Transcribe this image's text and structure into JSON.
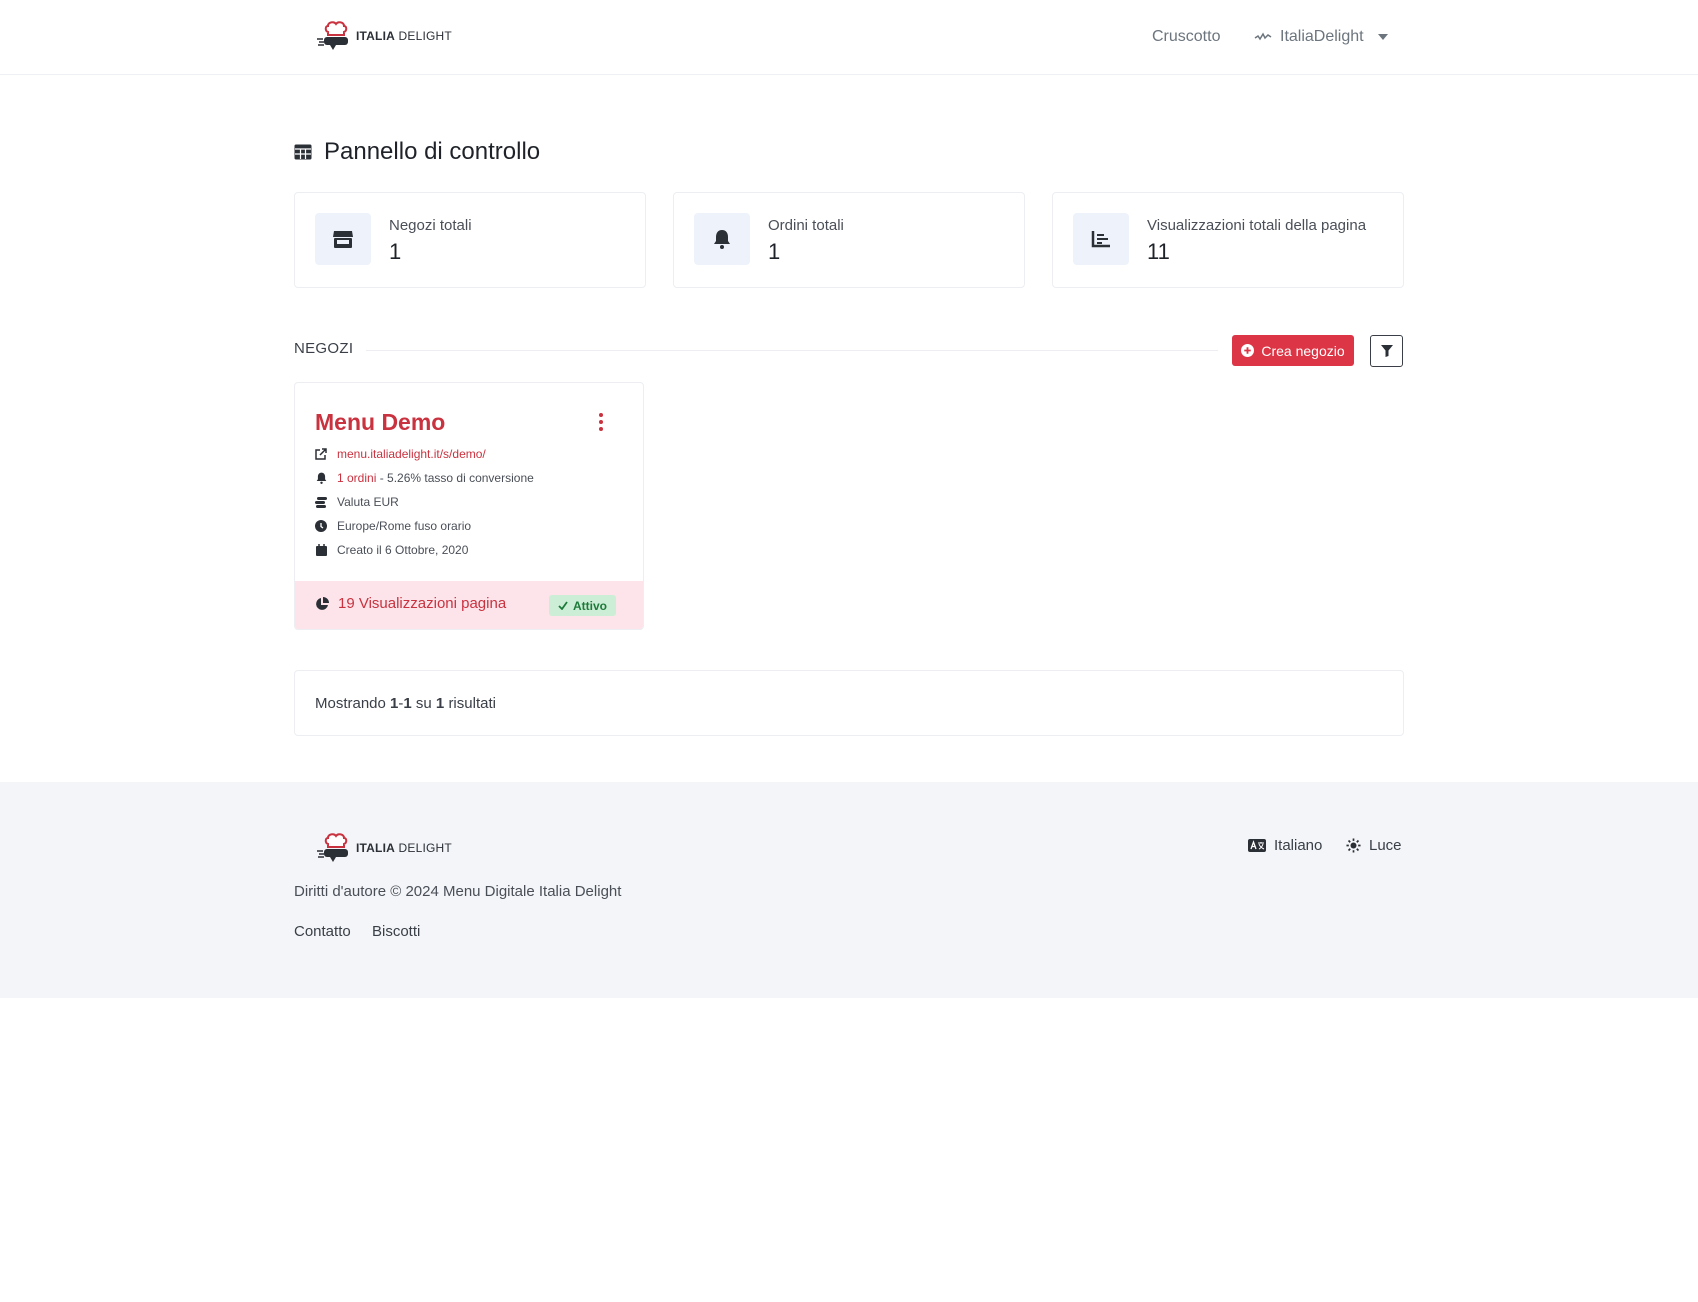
{
  "navbar": {
    "logo_text_bold": "ITALIA",
    "logo_text_light": "DELIGHT",
    "dashboard_link": "Cruscotto",
    "user_name": "ItaliaDelight"
  },
  "page": {
    "title": "Pannello di controllo"
  },
  "stats": [
    {
      "label": "Negozi totali",
      "value": "1",
      "icon": "store-icon"
    },
    {
      "label": "Ordini totali",
      "value": "1",
      "icon": "bell-icon"
    },
    {
      "label": "Visualizzazioni totali della pagina",
      "value": "11",
      "icon": "bar-chart-icon"
    }
  ],
  "stores_section": {
    "heading": "NEGOZI",
    "create_label": "Crea negozio"
  },
  "store": {
    "name": "Menu Demo",
    "url": "menu.italiadelight.it/s/demo/",
    "orders_link": "1 ordini",
    "orders_rest": "- 5.26% tasso di conversione",
    "currency": "Valuta EUR",
    "timezone": "Europe/Rome fuso orario",
    "created": "Creato il 6 Ottobre, 2020",
    "views": "19 Visualizzazioni pagina",
    "status": "Attivo"
  },
  "results": {
    "prefix": "Mostrando",
    "from": "1",
    "dash": "-",
    "to": "1",
    "of": "su",
    "total": "1",
    "suffix": "risultati"
  },
  "footer": {
    "copyright": "Diritti d'autore © 2024 Menu Digitale Italia Delight",
    "contact": "Contatto",
    "cookies": "Biscotti",
    "language": "Italiano",
    "theme": "Luce"
  },
  "colors": {
    "accent": "#dc3545",
    "brand_red": "#c9323f",
    "success_bg": "#cdeed6"
  }
}
